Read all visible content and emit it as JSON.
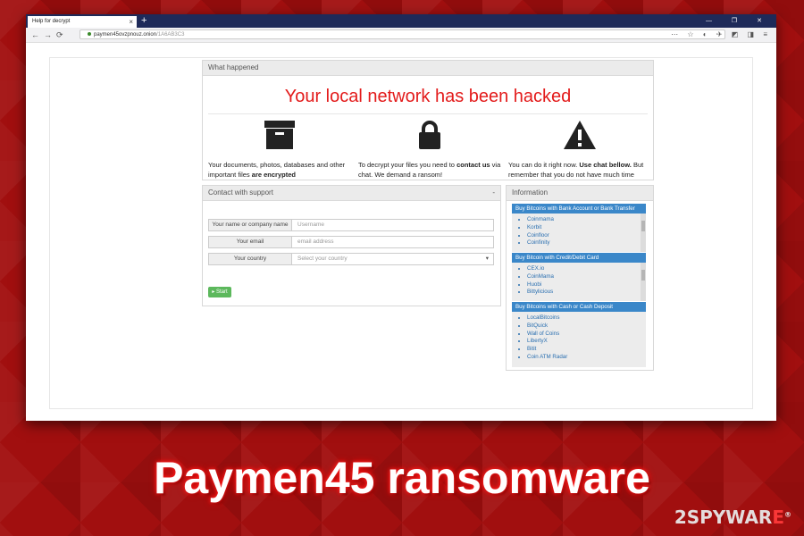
{
  "browser": {
    "tab_title": "Help for decrypt",
    "tab_close": "×",
    "new_tab": "+",
    "window_controls": "—  ❐  ✕",
    "url_host": "paymen45ovzpnouz.onion",
    "url_path": "/1A6AB3C3",
    "back": "←",
    "forward": "→",
    "reload": "⟳",
    "toolbar_icons": "⋯ ☆ ◐ ✈ ◩ ◨ ≡"
  },
  "what_happened": {
    "header": "What happened",
    "title": "Your local network has been hacked",
    "col1": {
      "pre": "Your documents, photos, databases and other important files ",
      "bold": "are encrypted",
      "post": ""
    },
    "col2": {
      "pre": "To decrypt your files you need to ",
      "bold": "contact us",
      "post": " via chat. We demand a ransom!"
    },
    "col3": {
      "pre": "You can do it right now. ",
      "bold": "Use chat bellow.",
      "post": " But remember that you do not have much time"
    }
  },
  "contact": {
    "header": "Contact with support",
    "header_mark": "-",
    "fields": [
      {
        "label": "Your name or company name",
        "placeholder": "Username"
      },
      {
        "label": "Your email",
        "placeholder": "email address"
      },
      {
        "label": "Your country",
        "placeholder": "Select your country"
      }
    ],
    "start": "▸ Start"
  },
  "information": {
    "header": "Information",
    "boxes": [
      {
        "title": "Buy Bitcoins with Bank Account or Bank Transfer",
        "items": [
          "Coinmama",
          "Korbit",
          "Coinfloor",
          "Coinfinity"
        ]
      },
      {
        "title": "Buy Bitcoin with Credit/Debit Card",
        "items": [
          "CEX.io",
          "CoinMama",
          "Huobi",
          "Bittylicious"
        ]
      },
      {
        "title": "Buy Bitcoins with Cash or Cash Deposit",
        "items": [
          "LocalBitcoins",
          "BitQuick",
          "Wall of Coins",
          "LibertyX",
          "Bitit",
          "Coin ATM Radar"
        ]
      }
    ]
  },
  "caption": "Paymen45 ransomware",
  "brand": {
    "num": "2",
    "a": "SPYWAR",
    "b": "E",
    "sup": "®"
  },
  "colors": {
    "title_red": "#e31b1b",
    "link_blue": "#2a6fb0",
    "box_blue": "#3a87c9",
    "start_green": "#5cb85c",
    "bg_red": "#a10f0f"
  }
}
